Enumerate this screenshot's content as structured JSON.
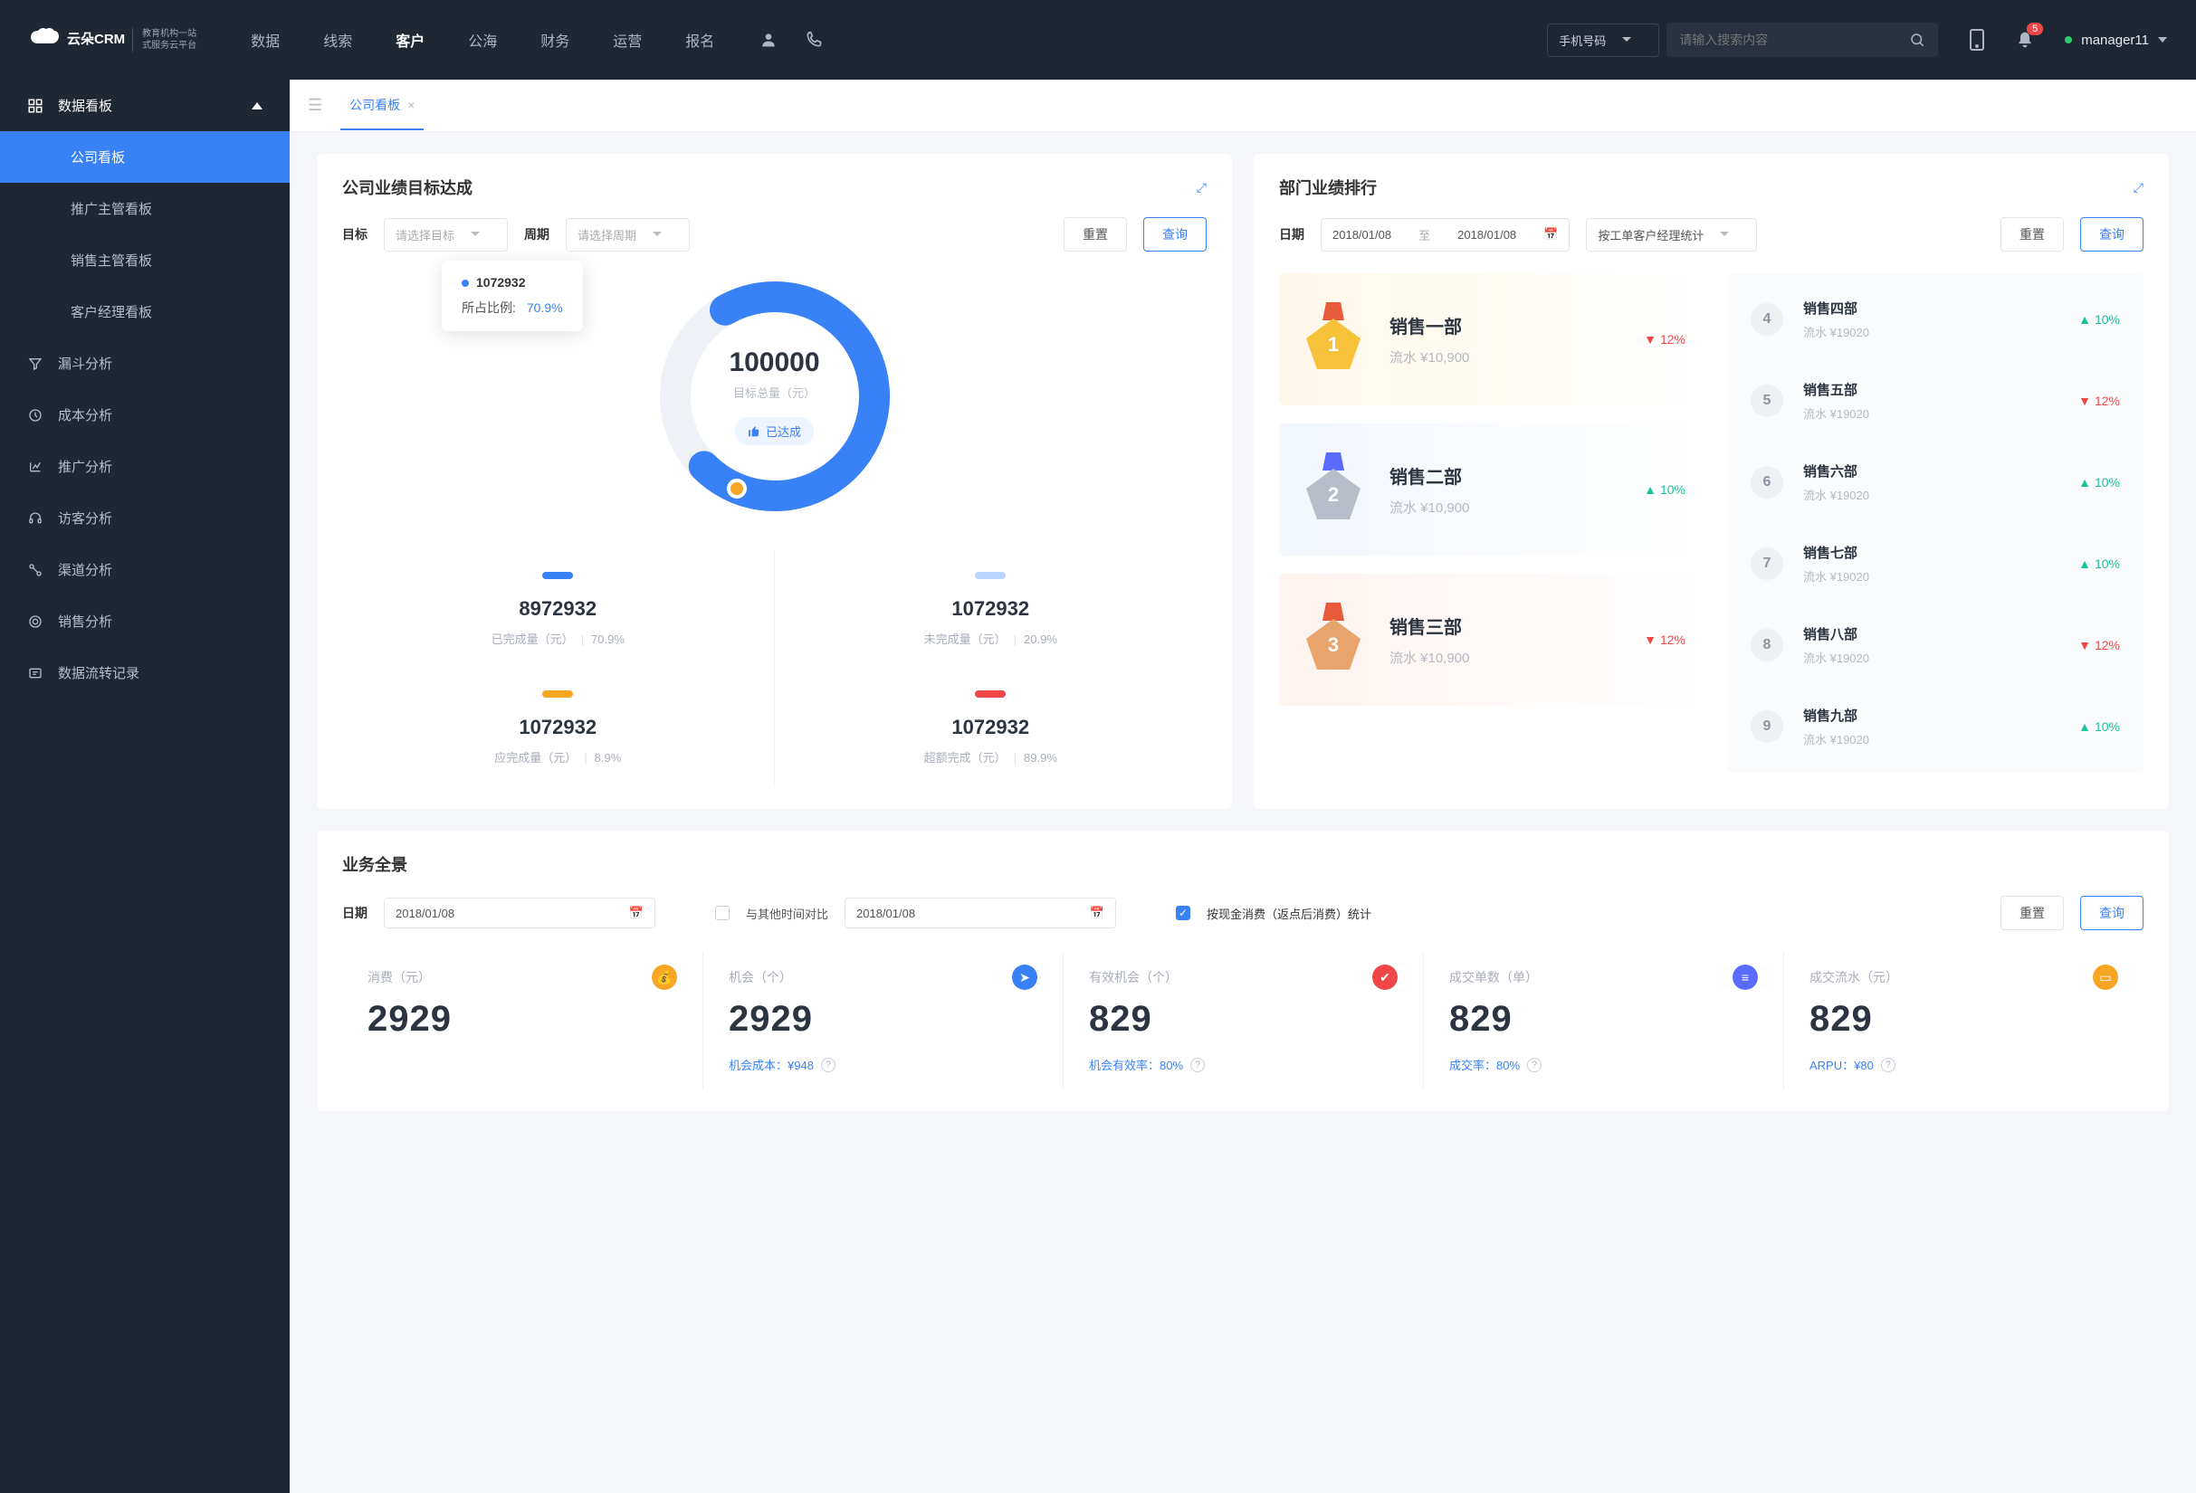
{
  "brand": {
    "name": "云朵CRM",
    "tag1": "教育机构一站",
    "tag2": "式服务云平台"
  },
  "nav": {
    "items": [
      "数据",
      "线索",
      "客户",
      "公海",
      "财务",
      "运营",
      "报名"
    ],
    "active": 2
  },
  "search": {
    "selector": "手机号码",
    "placeholder": "请输入搜索内容"
  },
  "notif_count": "5",
  "user": {
    "name": "manager11"
  },
  "sidebar": {
    "group": "数据看板",
    "subs": [
      "公司看板",
      "推广主管看板",
      "销售主管看板",
      "客户经理看板"
    ],
    "active_sub": 0,
    "items": [
      "漏斗分析",
      "成本分析",
      "推广分析",
      "访客分析",
      "渠道分析",
      "销售分析",
      "数据流转记录"
    ]
  },
  "tab": {
    "label": "公司看板"
  },
  "goal": {
    "title": "公司业绩目标达成",
    "target_label": "目标",
    "target_placeholder": "请选择目标",
    "period_label": "周期",
    "period_placeholder": "请选择周期",
    "reset": "重置",
    "query": "查询",
    "tooltip_value": "1072932",
    "tooltip_ratio_label": "所占比例:",
    "tooltip_ratio": "70.9%",
    "ring_value": "100000",
    "ring_sub": "目标总量（元）",
    "ring_tag": "已达成",
    "metrics": [
      {
        "mark": "blue",
        "value": "8972932",
        "label": "已完成量（元）",
        "pct": "70.9%"
      },
      {
        "mark": "lblue",
        "value": "1072932",
        "label": "未完成量（元）",
        "pct": "20.9%"
      },
      {
        "mark": "orange",
        "value": "1072932",
        "label": "应完成量（元）",
        "pct": "8.9%"
      },
      {
        "mark": "red",
        "value": "1072932",
        "label": "超额完成（元）",
        "pct": "89.9%"
      }
    ]
  },
  "rank": {
    "title": "部门业绩排行",
    "date_label": "日期",
    "date_from": "2018/01/08",
    "date_sep": "至",
    "date_to": "2018/01/08",
    "scope": "按工单客户经理统计",
    "reset": "重置",
    "query": "查询",
    "podium": [
      {
        "name": "销售一部",
        "sub": "流水 ¥10,900",
        "pct": "12%",
        "dir": "down"
      },
      {
        "name": "销售二部",
        "sub": "流水 ¥10,900",
        "pct": "10%",
        "dir": "up"
      },
      {
        "name": "销售三部",
        "sub": "流水 ¥10,900",
        "pct": "12%",
        "dir": "down"
      }
    ],
    "list": [
      {
        "n": "4",
        "name": "销售四部",
        "sub": "流水 ¥19020",
        "pct": "10%",
        "dir": "up"
      },
      {
        "n": "5",
        "name": "销售五部",
        "sub": "流水 ¥19020",
        "pct": "12%",
        "dir": "down"
      },
      {
        "n": "6",
        "name": "销售六部",
        "sub": "流水 ¥19020",
        "pct": "10%",
        "dir": "up"
      },
      {
        "n": "7",
        "name": "销售七部",
        "sub": "流水 ¥19020",
        "pct": "10%",
        "dir": "up"
      },
      {
        "n": "8",
        "name": "销售八部",
        "sub": "流水 ¥19020",
        "pct": "12%",
        "dir": "down"
      },
      {
        "n": "9",
        "name": "销售九部",
        "sub": "流水 ¥19020",
        "pct": "10%",
        "dir": "up"
      }
    ]
  },
  "overview": {
    "title": "业务全景",
    "date_label": "日期",
    "date1": "2018/01/08",
    "compare_label": "与其他时间对比",
    "date2": "2018/01/08",
    "stat_label": "按现金消费（返点后消费）统计",
    "reset": "重置",
    "query": "查询",
    "cells": [
      {
        "label": "消费（元）",
        "value": "2929",
        "sub": "",
        "icon": "ic-o"
      },
      {
        "label": "机会（个）",
        "value": "2929",
        "sub": "机会成本：¥948",
        "icon": "ic-b"
      },
      {
        "label": "有效机会（个）",
        "value": "829",
        "sub": "机会有效率：80%",
        "icon": "ic-r"
      },
      {
        "label": "成交单数（单）",
        "value": "829",
        "sub": "成交率：80%",
        "icon": "ic-i"
      },
      {
        "label": "成交流水（元）",
        "value": "829",
        "sub": "ARPU：¥80",
        "icon": "ic-y"
      }
    ]
  },
  "chart_data": {
    "type": "pie",
    "title": "目标总量（元）",
    "total": 100000,
    "series": [
      {
        "name": "已完成量（元）",
        "value": 8972932,
        "pct": 70.9
      },
      {
        "name": "未完成量（元）",
        "value": 1072932,
        "pct": 20.9
      },
      {
        "name": "应完成量（元）",
        "value": 1072932,
        "pct": 8.9
      },
      {
        "name": "超额完成（元）",
        "value": 1072932,
        "pct": 89.9
      }
    ]
  }
}
